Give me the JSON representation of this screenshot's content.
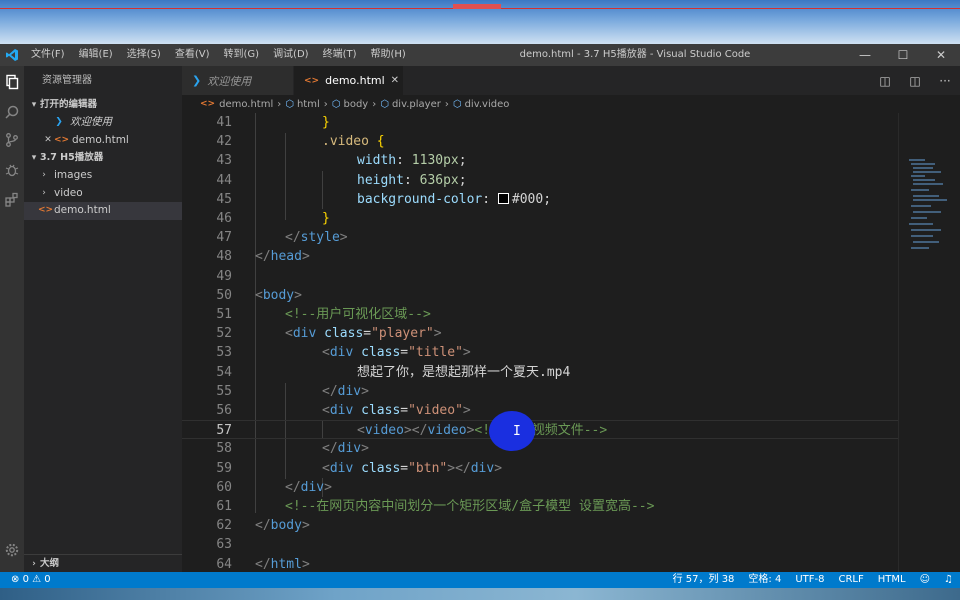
{
  "window": {
    "title": "demo.html - 3.7 H5播放器 - Visual Studio Code",
    "menu": [
      "文件(F)",
      "编辑(E)",
      "选择(S)",
      "查看(V)",
      "转到(G)",
      "调试(D)",
      "终端(T)",
      "帮助(H)"
    ]
  },
  "sidebar": {
    "header": "资源管理器",
    "open_editors_label": "打开的编辑器",
    "open_editors": [
      {
        "label": "欢迎使用"
      },
      {
        "label": "demo.html"
      }
    ],
    "folder_label": "3.7 H5播放器",
    "folder_items": [
      {
        "label": "images"
      },
      {
        "label": "video"
      },
      {
        "label": "demo.html"
      }
    ],
    "outline_label": "大纲"
  },
  "tabs": [
    {
      "label": "欢迎使用"
    },
    {
      "label": "demo.html"
    }
  ],
  "breadcrumb": [
    "demo.html",
    "html",
    "body",
    "div.player",
    "div.video"
  ],
  "editor": {
    "line_numbers": [
      "41",
      "42",
      "43",
      "44",
      "45",
      "46",
      "47",
      "48",
      "49",
      "50",
      "51",
      "52",
      "53",
      "54",
      "55",
      "56",
      "57",
      "58",
      "59",
      "60",
      "61",
      "62",
      "63",
      "64"
    ],
    "current_line": "57"
  },
  "code": {
    "l41": "}",
    "l42_sel": ".video",
    "l42_brace": " {",
    "l43_prop": "width",
    "l43_val": "1130px",
    "l44_prop": "height",
    "l44_val": "636px",
    "l45_prop": "background-color",
    "l45_val": "#000",
    "l46": "}",
    "l47_tag": "style",
    "l48_tag": "head",
    "l50_tag": "body",
    "l51_comment": "<!--用户可视化区域-->",
    "l52_tag": "div",
    "l52_attr": "class",
    "l52_val": "\"player\"",
    "l53_tag": "div",
    "l53_attr": "class",
    "l53_val": "\"title\"",
    "l54_text": "想起了你，是想起那样一个夏天.mp4",
    "l55_tag": "div",
    "l56_tag": "div",
    "l56_attr": "class",
    "l56_val": "\"video\"",
    "l57_tag_open": "video",
    "l57_tag_close": "video",
    "l57_comment": "<!--引入视频文件-->",
    "l58_tag": "div",
    "l59_tag": "div",
    "l59_attr": "class",
    "l59_val": "\"btn\"",
    "l59_tag_close": "div",
    "l60_tag": "div",
    "l61_comment": "<!--在网页内容中间划分一个矩形区域/盒子模型 设置宽高-->",
    "l62_tag": "body",
    "l64_tag": "html"
  },
  "status": {
    "problems": "0",
    "warnings": "0",
    "position": "行 57，列 38",
    "spaces": "空格: 4",
    "encoding": "UTF-8",
    "eol": "CRLF",
    "language": "HTML"
  },
  "colors": {
    "statusbar": "#007acc",
    "editor_bg": "#1e1e1e",
    "sidebar_bg": "#252526"
  }
}
